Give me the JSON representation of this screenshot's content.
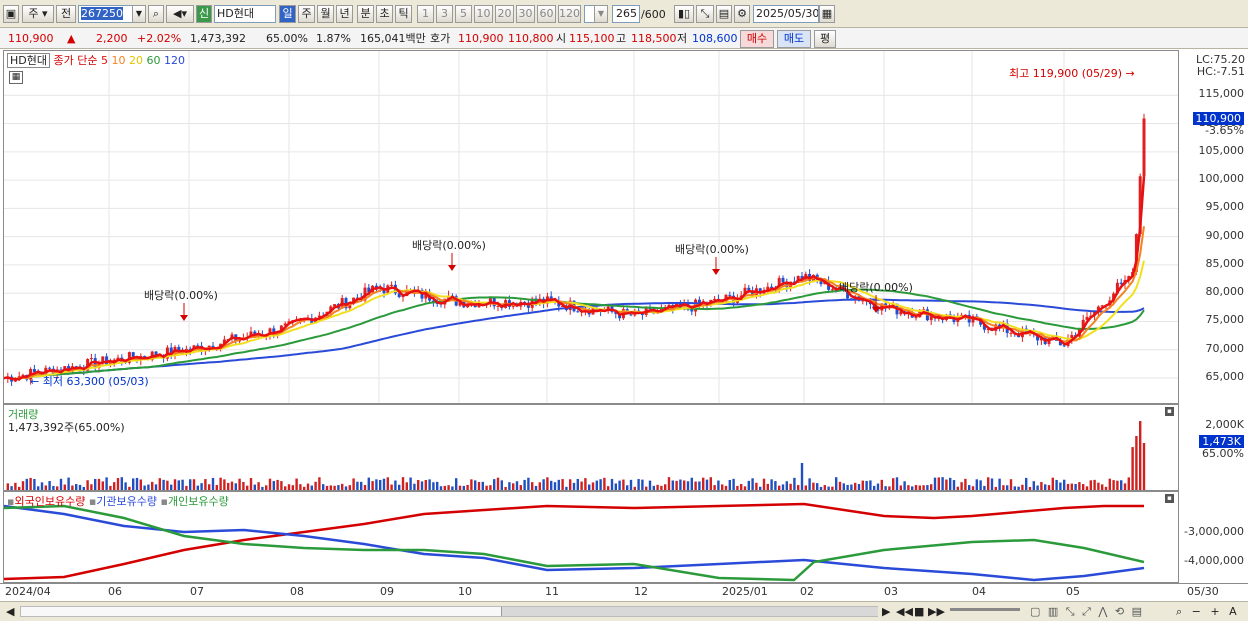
{
  "toolbar": {
    "period_unit": "주",
    "prev_label": "전",
    "code": "267250",
    "new_badge": "신",
    "name": "HD현대",
    "tabs": [
      "일",
      "주",
      "월",
      "년",
      "분",
      "초",
      "틱"
    ],
    "intervals": [
      "1",
      "3",
      "5",
      "10",
      "20",
      "30",
      "60",
      "120"
    ],
    "count": "265",
    "count_total": "/600",
    "date": "2025/05/30"
  },
  "quote": {
    "price": "110,900",
    "change": "2,200",
    "change_pct": "+2.02%",
    "volume": "1,473,392",
    "vol_ratio": "65.00%",
    "turnover_pct": "1.87%",
    "amount": "165,041백만",
    "hoga_label": "호가",
    "ask": "110,900",
    "bid": "110,800",
    "open_label": "시",
    "open": "115,100",
    "high_label": "고",
    "high": "118,500",
    "low_label": "저",
    "low": "108,600",
    "buy_label": "매수",
    "sell_label": "매도",
    "eval_label": "평"
  },
  "price_pane": {
    "stock_label": "HD현대",
    "ma_label": "종가 단순",
    "ma_periods": [
      "5",
      "10",
      "20",
      "60",
      "120"
    ],
    "ma_colors": [
      "#e81010",
      "#f58220",
      "#f2e020",
      "#2a9a3a",
      "#2a4ad8"
    ],
    "lc": "LC:75.20",
    "hc": "HC:-7.51",
    "current_tag": "110,900",
    "current_pct": "-3.65%",
    "max_note": "최고 119,900 (05/29)",
    "min_note": "최저 63,300 (05/03)",
    "dividend_notes": [
      "배당락(0.00%)",
      "배당락(0.00%)",
      "배당락(0.00%)",
      "배당락(0.00%)"
    ],
    "y_ticks": [
      "115,000",
      "110,000",
      "105,000",
      "100,000",
      "95,000",
      "90,000",
      "85,000",
      "80,000",
      "75,000",
      "70,000",
      "65,000"
    ]
  },
  "volume_pane": {
    "title": "거래량",
    "value_note": "1,473,392주(65.00%)",
    "y_tick": "2,000K",
    "current_tag": "1,473K",
    "current_pct": "65.00%"
  },
  "holdings_pane": {
    "legend": [
      {
        "label": "외국인보유수량",
        "color": "#d40000"
      },
      {
        "label": "기관보유수량",
        "color": "#2a4ad8"
      },
      {
        "label": "개인보유수량",
        "color": "#2a9a3a"
      }
    ],
    "y_ticks": [
      "-3,000,000",
      "-4,000,000"
    ]
  },
  "x_axis": {
    "labels": [
      "2024/04",
      "06",
      "07",
      "08",
      "09",
      "10",
      "11",
      "12",
      "2025/01",
      "02",
      "03",
      "04",
      "05"
    ],
    "last_label": "05/30"
  },
  "chart_data": {
    "type": "line",
    "x": [
      "2024/04",
      "2024/05",
      "2024/06",
      "2024/07",
      "2024/08",
      "2024/09",
      "2024/10",
      "2024/11",
      "2024/12",
      "2025/01",
      "2025/02",
      "2025/03",
      "2025/04",
      "2025/05",
      "2025/05/30"
    ],
    "series": [
      {
        "name": "종가",
        "values": [
          65000,
          68000,
          70000,
          74000,
          81000,
          78500,
          78500,
          76000,
          78500,
          83000,
          77500,
          75000,
          71000,
          84000,
          110900
        ]
      }
    ],
    "ylim": [
      62000,
      120000
    ],
    "max": {
      "value": 119900,
      "date": "05/29"
    },
    "min": {
      "value": 63300,
      "date": "05/03"
    }
  }
}
